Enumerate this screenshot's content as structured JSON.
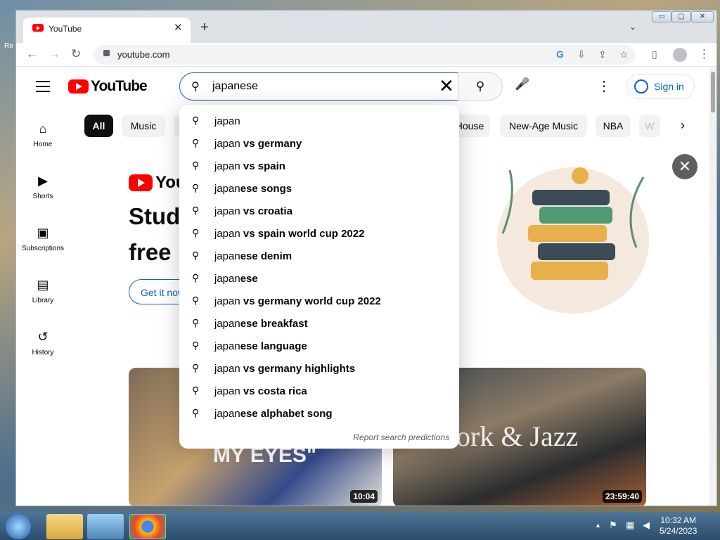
{
  "desktop": {
    "label": "Re"
  },
  "window": {
    "controls": [
      "▭",
      "▢",
      "✕"
    ]
  },
  "tab": {
    "title": "YouTube",
    "close": "✕"
  },
  "browser": {
    "new_tab": "+",
    "tabs_menu": "⌄",
    "back": "←",
    "forward": "→",
    "reload": "↻",
    "url": "youtube.com",
    "menu": "⋮"
  },
  "youtube": {
    "logo_text": "YouTube",
    "search": {
      "value": "japanese",
      "clear": "✕"
    },
    "mic": "🎤",
    "more": "⋮",
    "sign_in": "Sign in",
    "chips": [
      "All",
      "Music",
      "House",
      "New-Age Music",
      "NBA",
      "W"
    ],
    "chip_next": "›",
    "sidebar": [
      {
        "label": "Home",
        "icon": "home-icon",
        "glyph": "⌂"
      },
      {
        "label": "Shorts",
        "icon": "shorts-icon",
        "glyph": "▶"
      },
      {
        "label": "Subscriptions",
        "icon": "subscriptions-icon",
        "glyph": "▣"
      },
      {
        "label": "Library",
        "icon": "library-icon",
        "glyph": "▤"
      },
      {
        "label": "History",
        "icon": "history-icon",
        "glyph": "↺"
      }
    ],
    "promo": {
      "logo_text": "You",
      "line1": "Stud",
      "line2": "free",
      "button": "Get it now",
      "dismiss": "✕"
    },
    "videos": [
      {
        "duration": "10:04",
        "thumb_text": "MY EYES\""
      },
      {
        "duration": "23:59:40",
        "thumb_text": "ork & Jazz"
      }
    ],
    "suggestions": [
      {
        "prefix": "japan",
        "suffix": ""
      },
      {
        "prefix": "japan",
        "suffix": " vs germany"
      },
      {
        "prefix": "japan",
        "suffix": " vs spain"
      },
      {
        "prefix": "japan",
        "suffix": "ese songs"
      },
      {
        "prefix": "japan",
        "suffix": " vs croatia"
      },
      {
        "prefix": "japan",
        "suffix": " vs spain world cup 2022"
      },
      {
        "prefix": "japan",
        "suffix": "ese denim"
      },
      {
        "prefix": "japan",
        "suffix": "ese"
      },
      {
        "prefix": "japan",
        "suffix": " vs germany world cup 2022"
      },
      {
        "prefix": "japan",
        "suffix": "ese breakfast"
      },
      {
        "prefix": "japan",
        "suffix": "ese language"
      },
      {
        "prefix": "japan",
        "suffix": " vs germany highlights"
      },
      {
        "prefix": "japan",
        "suffix": " vs costa rica"
      },
      {
        "prefix": "japan",
        "suffix": "ese alphabet song"
      }
    ],
    "report": "Report search predictions"
  },
  "taskbar": {
    "time": "10:32 AM",
    "date": "5/24/2023",
    "tray_up": "▲"
  },
  "colors": {
    "brand_red": "#ff0000",
    "link_blue": "#065fd4",
    "search_border": "#1c62b9"
  }
}
